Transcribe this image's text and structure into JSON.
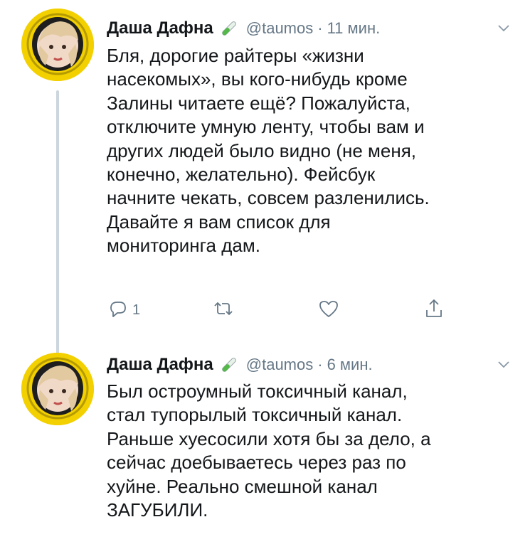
{
  "tweets": [
    {
      "author": {
        "name": "Даша Дафна",
        "emoji": "test-tube-icon",
        "handle": "@taumos"
      },
      "separator": "·",
      "time": "11 мин.",
      "text_lines": [
        "Бля, дорогие райтеры «жизни",
        "насекомых», вы кого-нибудь кроме",
        "Залины читаете ещё? Пожалуйста,",
        "отключите умную ленту, чтобы вам и",
        "других людей было видно (не меня,",
        "конечно, желательно). Фейсбук",
        "начните чекать, совсем разленились.",
        "Давайте я вам список для",
        "мониторинга дам."
      ],
      "actions": {
        "reply_count": "1"
      }
    },
    {
      "author": {
        "name": "Даша Дафна",
        "emoji": "test-tube-icon",
        "handle": "@taumos"
      },
      "separator": "·",
      "time": "6 мин.",
      "text_lines": [
        "Был остроумный токсичный канал,",
        "стал тупорылый токсичный канал.",
        "Раньше хуесосили хотя бы за дело, а",
        "сейчас доебываетесь через раз по",
        "хуйне. Реально смешной канал",
        "ЗАГУБИЛИ."
      ]
    }
  ],
  "colors": {
    "text": "#14171a",
    "secondary": "#657786",
    "thread_line": "#cdd6dd",
    "avatar_bg": "#f3d000"
  }
}
